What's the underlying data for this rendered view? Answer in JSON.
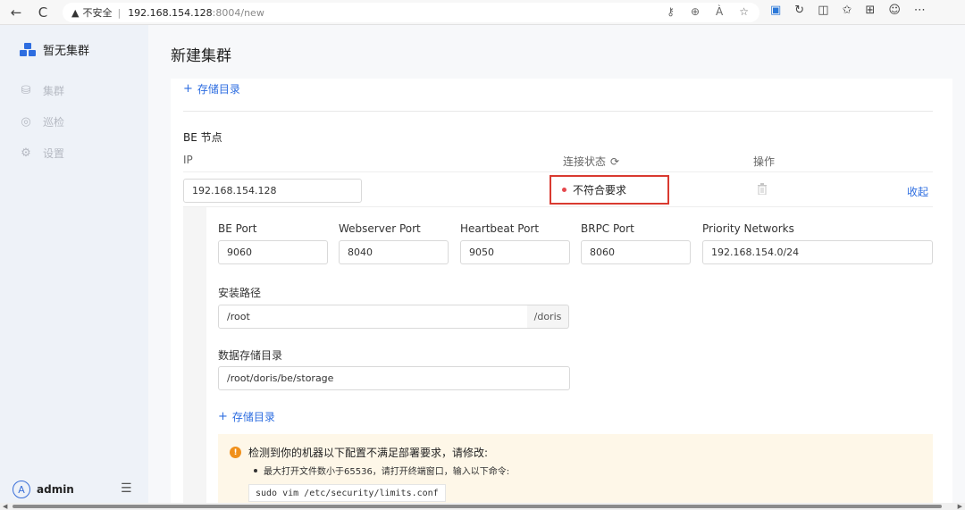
{
  "browser": {
    "security_label": "不安全",
    "separator": "|",
    "url_host": "192.168.154.128",
    "url_path": ":8004/new",
    "read_aloud": "À",
    "back": "←",
    "reload": "C"
  },
  "sidebar": {
    "brand": "暂无集群",
    "items": [
      {
        "label": "集群",
        "icon": "cluster-icon"
      },
      {
        "label": "巡检",
        "icon": "inspect-icon"
      },
      {
        "label": "设置",
        "icon": "gear-icon"
      }
    ],
    "user": {
      "avatar": "A",
      "name": "admin"
    }
  },
  "page": {
    "title": "新建集群",
    "add_storage_top": "存储目录",
    "be_section": "BE 节点",
    "columns": {
      "ip": "IP",
      "status": "连接状态",
      "action": "操作"
    },
    "node": {
      "ip": "192.168.154.128",
      "status": "不符合要求",
      "collapse": "收起"
    },
    "ports": [
      {
        "label": "BE Port",
        "value": "9060"
      },
      {
        "label": "Webserver Port",
        "value": "8040"
      },
      {
        "label": "Heartbeat Port",
        "value": "9050"
      },
      {
        "label": "BRPC Port",
        "value": "8060"
      },
      {
        "label": "Priority Networks",
        "value": "192.168.154.0/24"
      }
    ],
    "install_path": {
      "label": "安装路径",
      "value": "/root",
      "suffix": "/doris"
    },
    "data_dir": {
      "label": "数据存储目录",
      "value": "/root/doris/be/storage"
    },
    "add_storage_bottom": "存储目录",
    "alert": {
      "title": "检测到你的机器以下配置不满足部署要求，请修改:",
      "item": "最大打开文件数小于65536，请打开终端窗口，输入以下命令:",
      "code": "sudo vim /etc/security/limits.conf"
    }
  },
  "colors": {
    "accent": "#2d6de0",
    "error": "#d93a30",
    "warning": "#f0901a"
  }
}
